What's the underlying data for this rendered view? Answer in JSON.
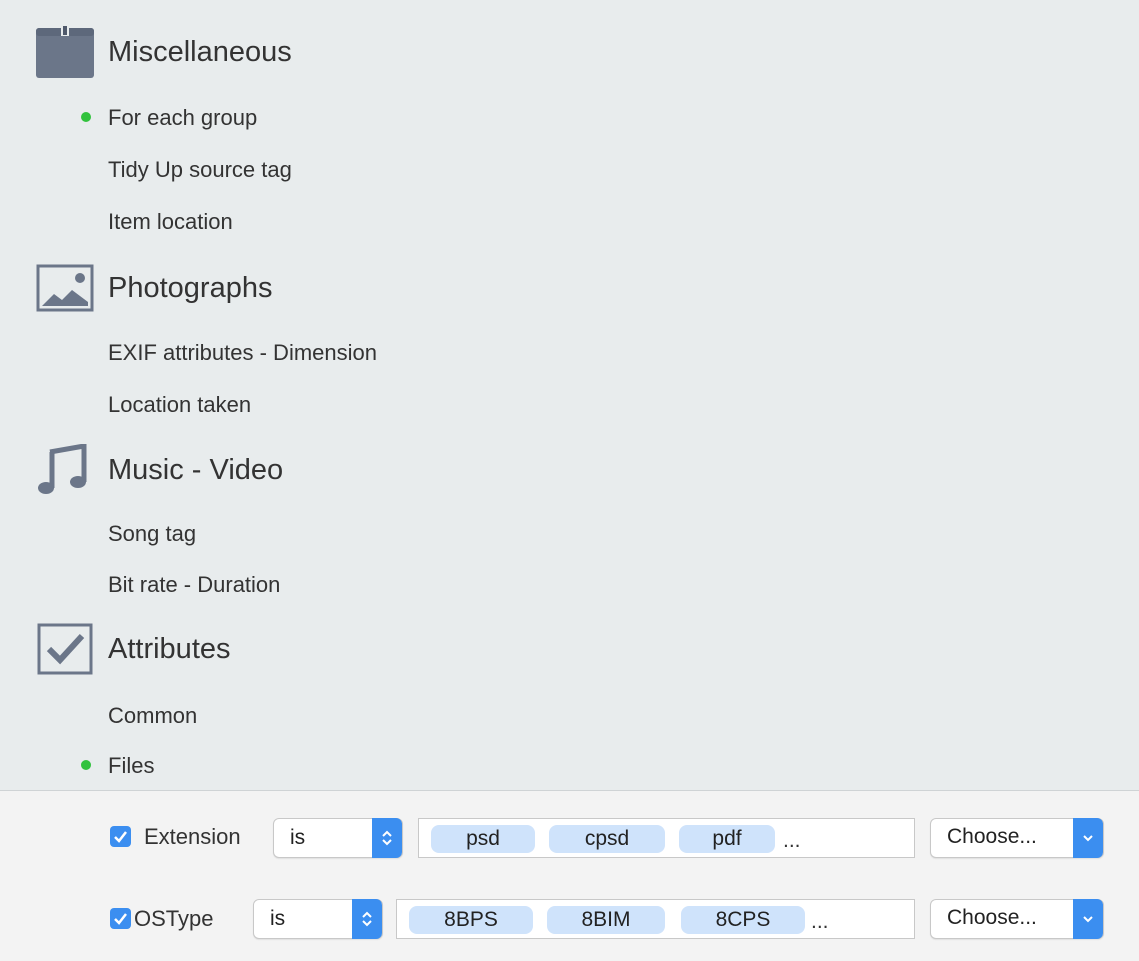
{
  "categories": [
    {
      "title": "Miscellaneous",
      "icon": "box-icon",
      "items": [
        "For each group",
        "Tidy Up source tag",
        "Item location"
      ]
    },
    {
      "title": "Photographs",
      "icon": "photo-icon",
      "items": [
        "EXIF attributes - Dimension",
        "Location taken"
      ]
    },
    {
      "title": "Music - Video",
      "icon": "music-note-icon",
      "items": [
        "Song tag",
        "Bit rate - Duration"
      ]
    },
    {
      "title": "Attributes",
      "icon": "checkbox-icon",
      "items": [
        "Common",
        "Files"
      ]
    }
  ],
  "active_items": [
    "For each group",
    "Files"
  ],
  "accent_color": "#3b8ef0",
  "active_dot_color": "#31c23d",
  "rules": [
    {
      "checked": true,
      "label": "Extension",
      "operator": "is",
      "tokens": [
        "psd",
        "cpsd",
        "pdf"
      ],
      "overflow": "...",
      "choose_label": "Choose..."
    },
    {
      "checked": true,
      "label": "OSType",
      "operator": "is",
      "tokens": [
        "8BPS",
        "8BIM",
        "8CPS"
      ],
      "overflow": "...",
      "choose_label": "Choose..."
    }
  ]
}
